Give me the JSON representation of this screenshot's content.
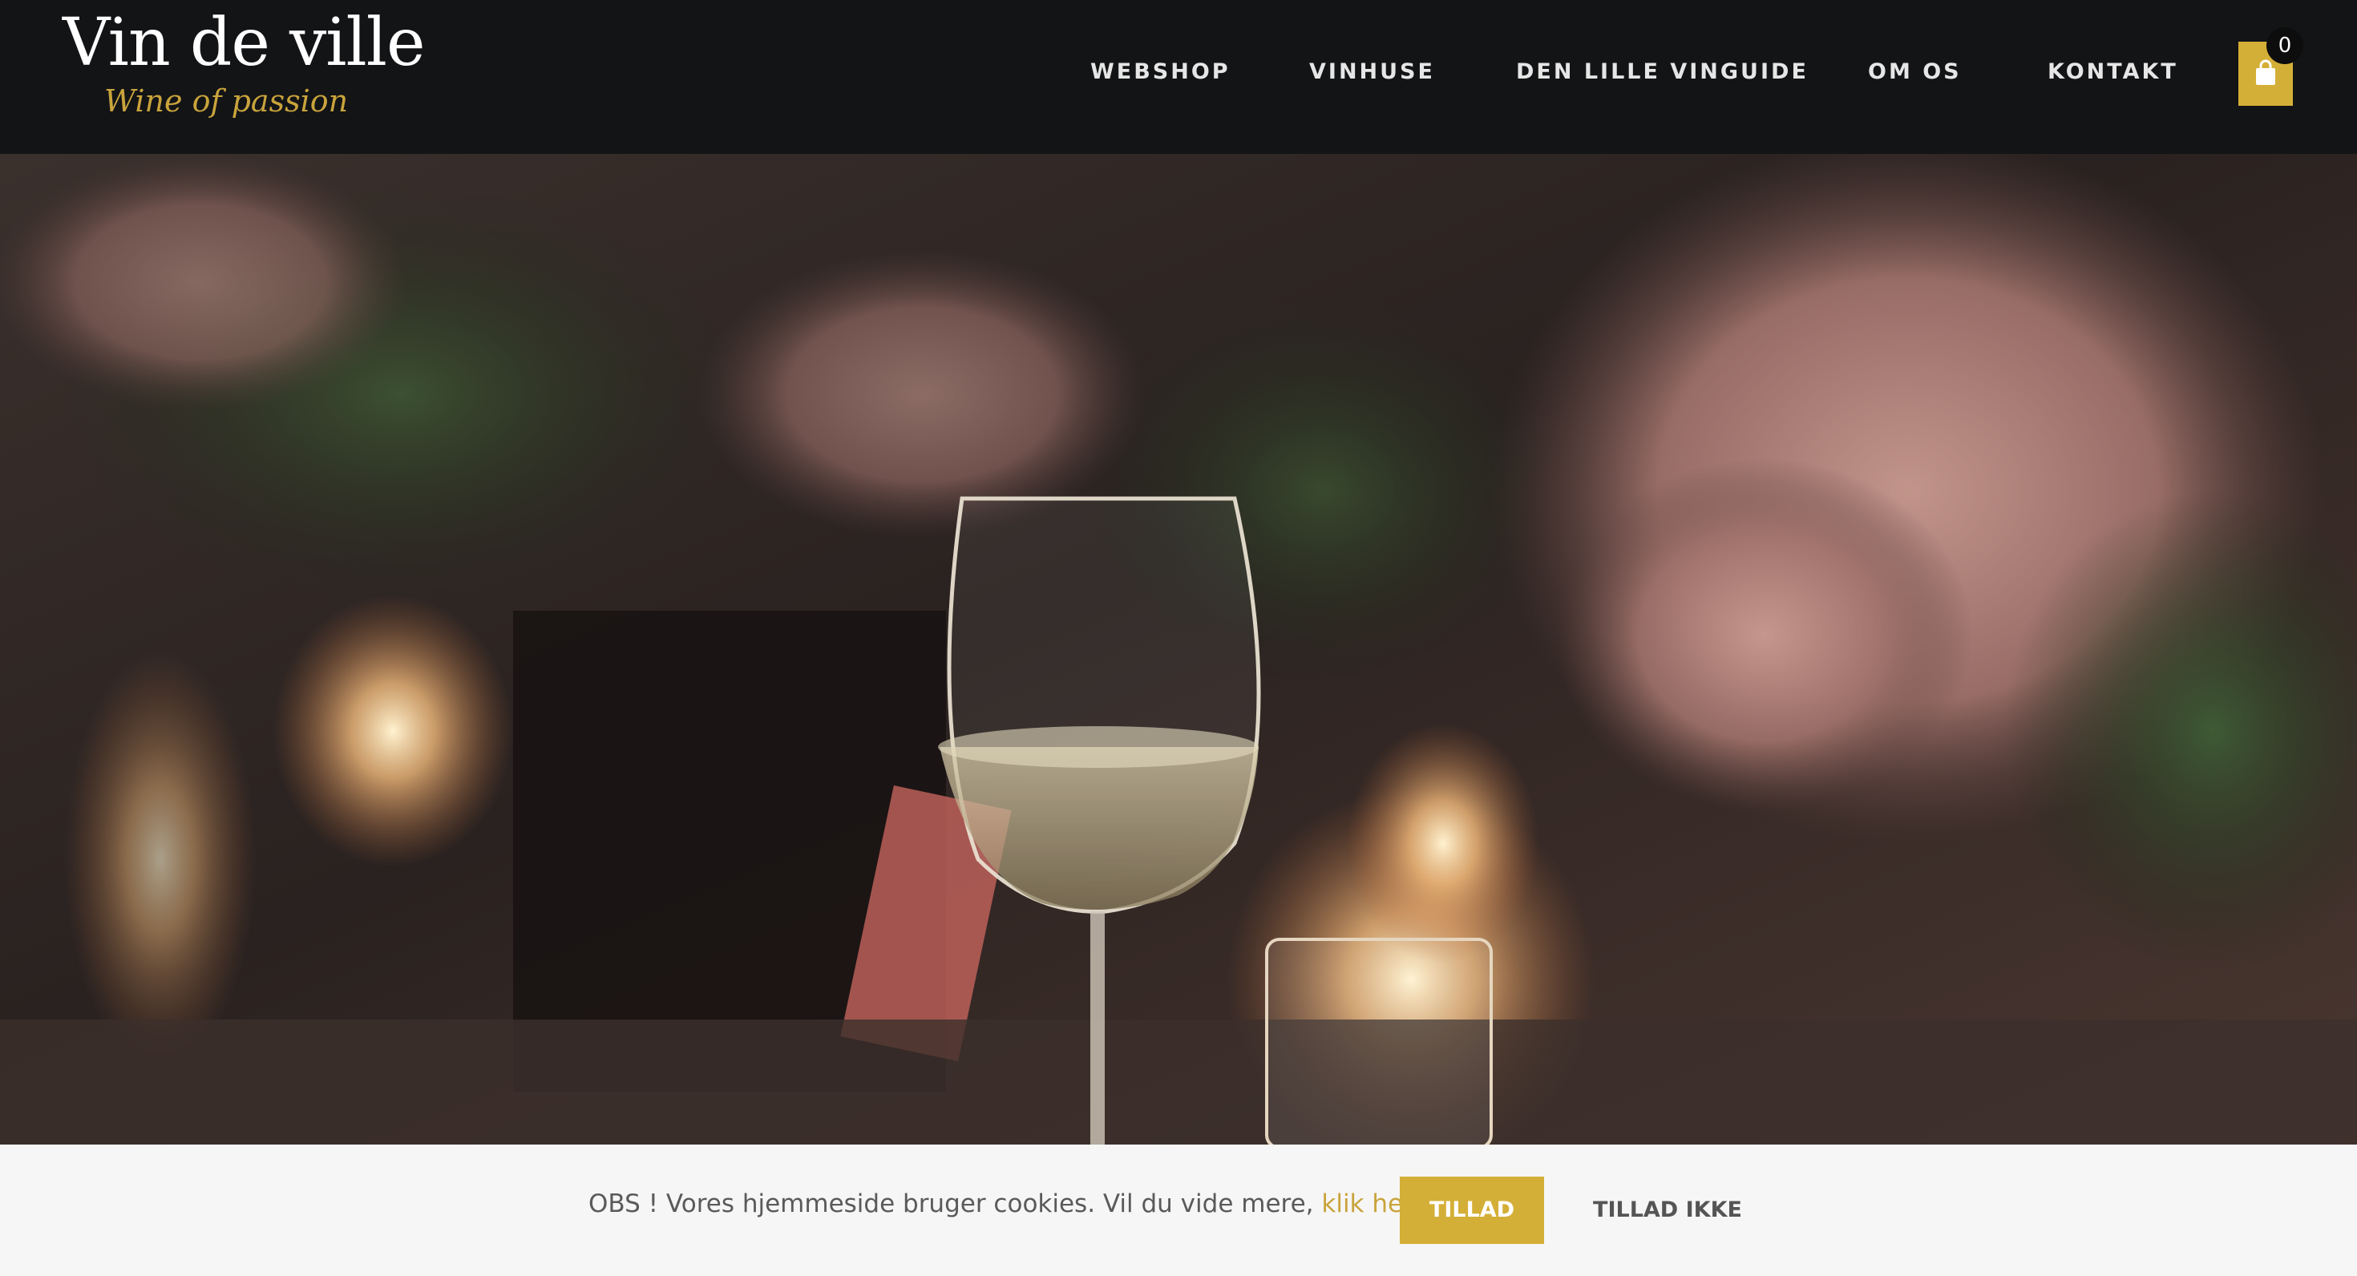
{
  "header": {
    "logo_title": "Vin de ville",
    "logo_tagline": "Wine of passion",
    "nav": [
      "WEBSHOP",
      "VINHUSE",
      "DEN LILLE VINGUIDE",
      "OM OS",
      "KONTAKT"
    ],
    "cart_count": "0",
    "cart_icon": "shopping-bag-icon"
  },
  "cookie": {
    "text_before": "OBS ! Vores hjemmeside bruger cookies. Vil du vide mere, ",
    "link": "klik her",
    "text_after": ".",
    "allow": "TILLAD",
    "deny": "TILLAD IKKE"
  },
  "colors": {
    "header_bg": "#131416",
    "accent": "#d4af37",
    "cookie_bg": "#f6f6f6"
  }
}
